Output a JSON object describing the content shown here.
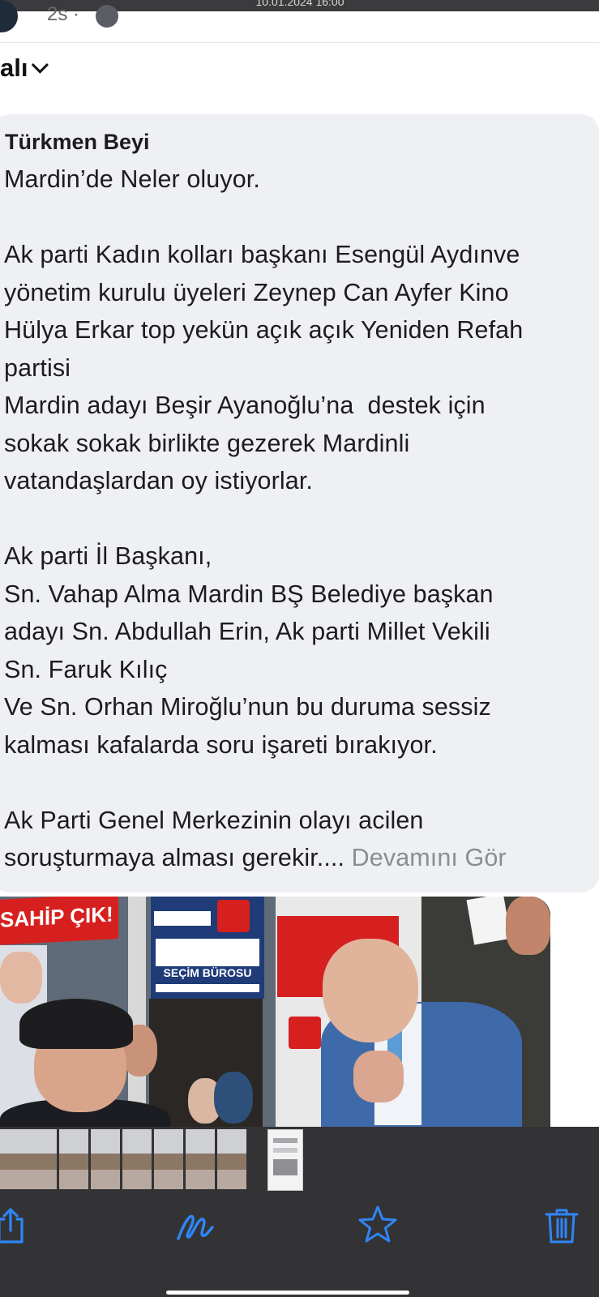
{
  "status_bar": {
    "time": "10.01.2024 16:00"
  },
  "post_header": {
    "meta": "2s ·",
    "globe_icon": "globe-icon"
  },
  "filter": {
    "label": "alı",
    "icon": "chevron-down-icon"
  },
  "post": {
    "author": "Türkmen Beyi",
    "text": "Mardin’de Neler oluyor.\n\nAk parti Kadın kolları başkanı Esengül Aydınve\nyönetim kurulu üyeleri Zeynep Can Ayfer Kino\nHülya Erkar top yekün açık açık Yeniden Refah\npartisi\nMardin adayı Beşir Ayanoğlu’na  destek için\nsokak sokak birlikte gezerek Mardinli\nvatandaşlardan oy istiyorlar.\n\nAk parti İl Başkanı,\nSn. Vahap Alma Mardin BŞ Belediye başkan\nadayı Sn. Abdullah Erin, Ak parti Millet Vekili\nSn. Faruk Kılıç\nVe Sn. Orhan Miroğlu’nun bu duruma sessiz\nkalması kafalarda soru işareti bırakıyor.\n\nAk Parti Genel Merkezinin olayı acilen\nsoruşturmaya alması gerekir.... ",
    "see_more": "Devamını Gör"
  },
  "photo": {
    "sign_left": "SAHİP ÇIK!",
    "office_sign": "SEÇİM BÜROSU"
  },
  "thumbnails": {
    "count": 9,
    "selected_index": 8
  },
  "toolbar": {
    "share_icon": "share-icon",
    "markup_icon": "markup-icon",
    "favorite_icon": "star-icon",
    "delete_icon": "trash-icon"
  },
  "colors": {
    "accent": "#2f86f6",
    "bubble": "#eff0f4",
    "toolbar_bg": "#333336"
  }
}
